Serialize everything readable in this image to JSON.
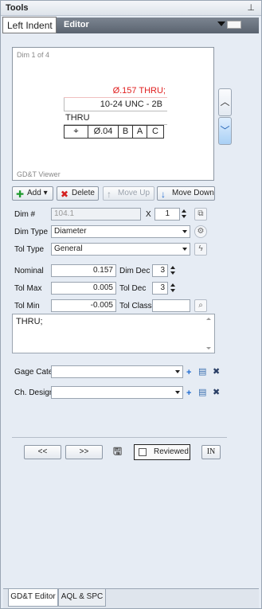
{
  "panel": {
    "title": "Tools",
    "pin_icon": "pin-icon"
  },
  "editor": {
    "tooltip": "Left Indent",
    "title": "Editor"
  },
  "viewer": {
    "counter": "Dim 1 of 4",
    "label": "GD&T Viewer",
    "callout": {
      "line1": "Ø.157 THRU;",
      "line2": "10-24 UNC - 2B",
      "line3": "THRU",
      "frame": [
        "⌖",
        "Ø.04",
        "B",
        "A",
        "C"
      ]
    },
    "callout_color": "#e02020"
  },
  "toolbar": {
    "add": "Add",
    "delete": "Delete",
    "move_up": "Move Up",
    "move_down": "Move Down"
  },
  "form": {
    "dim_no_label": "Dim #",
    "dim_no_value": "104.1",
    "x_label": "X",
    "x_value": "1",
    "dim_type_label": "Dim Type",
    "dim_type_value": "Diameter",
    "tol_type_label": "Tol Type",
    "tol_type_value": "General",
    "nominal_label": "Nominal",
    "nominal_value": "0.157",
    "dim_dec_label": "Dim Dec",
    "dim_dec_value": "3",
    "tol_max_label": "Tol Max",
    "tol_max_value": "0.005",
    "tol_dec_label": "Tol Dec",
    "tol_dec_value": "3",
    "tol_min_label": "Tol Min",
    "tol_min_value": "-0.005",
    "tol_class_label": "Tol Class",
    "tol_class_value": "",
    "notes_value": "THRU;",
    "gage_category_label": "Gage Category",
    "gage_category_value": "",
    "ch_designator_label": "Ch. Designator",
    "ch_designator_value": ""
  },
  "nav": {
    "prev": "<<",
    "next": ">>",
    "reviewed": "Reviewed",
    "units": "IN"
  },
  "tabs": [
    {
      "label": "GD&T Editor"
    },
    {
      "label": "AQL & SPC"
    }
  ]
}
